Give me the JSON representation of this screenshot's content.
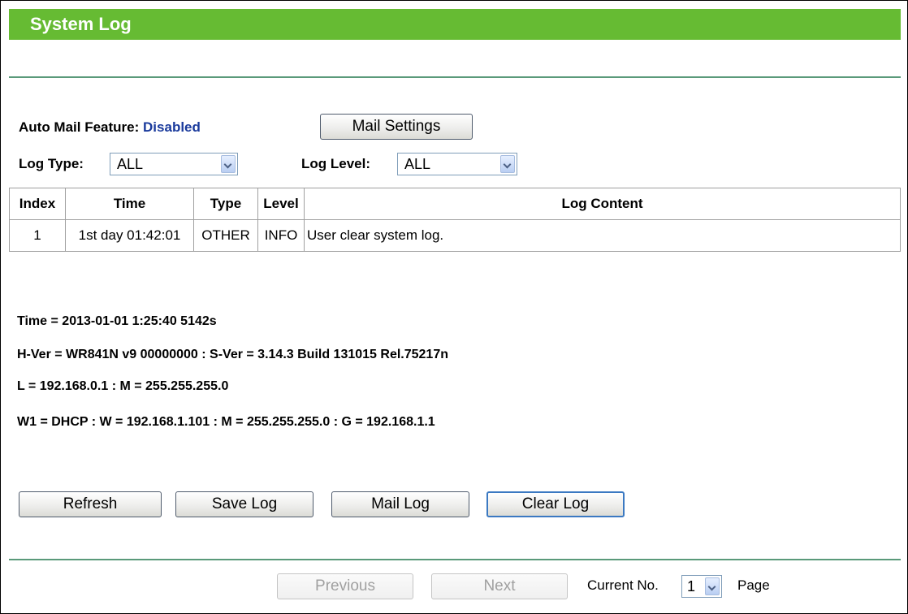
{
  "header": {
    "title": "System Log"
  },
  "mail": {
    "label": "Auto Mail Feature:",
    "status": "Disabled",
    "settings_button": "Mail Settings"
  },
  "filters": {
    "log_type_label": "Log Type:",
    "log_type_value": "ALL",
    "log_level_label": "Log Level:",
    "log_level_value": "ALL"
  },
  "table": {
    "columns": [
      "Index",
      "Time",
      "Type",
      "Level",
      "Log Content"
    ],
    "rows": [
      [
        "1",
        "1st day 01:42:01",
        "OTHER",
        "INFO",
        "User clear system log."
      ]
    ]
  },
  "info": {
    "line1": "Time = 2013-01-01 1:25:40 5142s",
    "line2": "H-Ver = WR841N v9 00000000 : S-Ver = 3.14.3 Build 131015 Rel.75217n",
    "line3": "L = 192.168.0.1 : M = 255.255.255.0",
    "line4": "W1 = DHCP : W = 192.168.1.101 : M = 255.255.255.0 : G = 192.168.1.1"
  },
  "actions": {
    "refresh": "Refresh",
    "save_log": "Save Log",
    "mail_log": "Mail Log",
    "clear_log": "Clear Log"
  },
  "pagination": {
    "previous": "Previous",
    "next": "Next",
    "current_label": "Current No.",
    "current_value": "1",
    "page_label": "Page"
  },
  "colors": {
    "header_bg": "#66bb33",
    "rule": "#5a9a7a",
    "status": "#1a3a9c"
  }
}
